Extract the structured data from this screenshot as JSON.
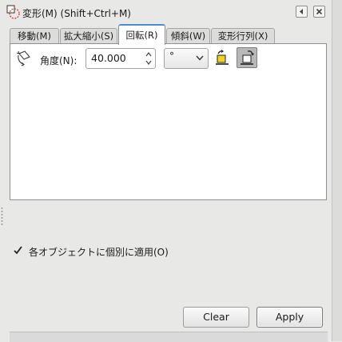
{
  "dialog": {
    "title": "変形(M) (Shift+Ctrl+M)"
  },
  "tabs": [
    {
      "label": "移動(M)",
      "active": false
    },
    {
      "label": "拡大縮小(S)",
      "active": false
    },
    {
      "label": "回転(R)",
      "active": true
    },
    {
      "label": "傾斜(W)",
      "active": false
    },
    {
      "label": "変形行列(X)",
      "active": false
    }
  ],
  "rotate": {
    "angle_label": "角度(N):",
    "angle_value": "40.000",
    "unit": "°",
    "direction_selected": "clockwise"
  },
  "options": {
    "apply_each_label": "各オブジェクトに個別に適用(O)",
    "apply_each_checked": true
  },
  "buttons": {
    "clear": "Clear",
    "apply": "Apply"
  },
  "colors": {
    "active_tab_accent": "#4c8ed6",
    "panel_bg": "#ffffff",
    "window_bg": "#e8e8e7"
  }
}
